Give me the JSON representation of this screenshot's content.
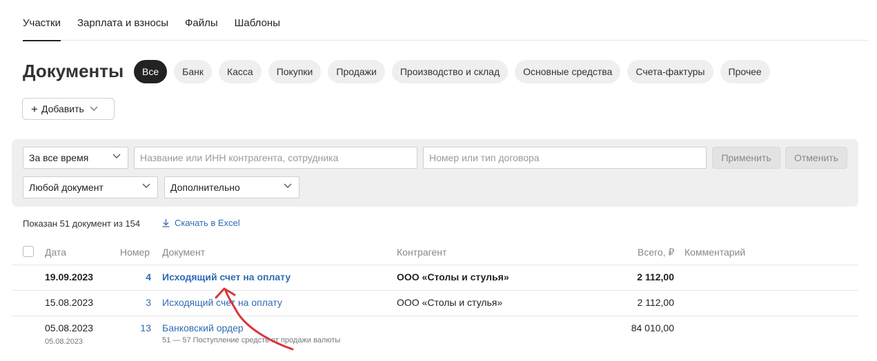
{
  "tabs": [
    {
      "label": "Участки",
      "active": true
    },
    {
      "label": "Зарплата и взносы",
      "active": false
    },
    {
      "label": "Файлы",
      "active": false
    },
    {
      "label": "Шаблоны",
      "active": false
    }
  ],
  "page_title": "Документы",
  "chips": [
    {
      "label": "Все",
      "active": true
    },
    {
      "label": "Банк",
      "active": false
    },
    {
      "label": "Касса",
      "active": false
    },
    {
      "label": "Покупки",
      "active": false
    },
    {
      "label": "Продажи",
      "active": false
    },
    {
      "label": "Производство и склад",
      "active": false
    },
    {
      "label": "Основные средства",
      "active": false
    },
    {
      "label": "Счета-фактуры",
      "active": false
    },
    {
      "label": "Прочее",
      "active": false
    }
  ],
  "add_button": {
    "label": "Добавить",
    "icon": "plus-icon"
  },
  "filters": {
    "period": "За все время",
    "contractor_placeholder": "Название или ИНН контрагента, сотрудника",
    "contract_placeholder": "Номер или тип договора",
    "apply": "Применить",
    "cancel": "Отменить",
    "doc_type": "Любой документ",
    "extra": "Дополнительно"
  },
  "summary": "Показан 51 документ из 154",
  "excel_link": "Скачать в Excel",
  "columns": {
    "date": "Дата",
    "number": "Номер",
    "document": "Документ",
    "contractor": "Контрагент",
    "total": "Всего, ₽",
    "comment": "Комментарий"
  },
  "rows": [
    {
      "date": "19.09.2023",
      "number": "4",
      "document": "Исходящий счет на оплату",
      "contractor": "ООО «Столы и стулья»",
      "total": "2 112,00"
    },
    {
      "date": "15.08.2023",
      "number": "3",
      "document": "Исходящий счет на оплату",
      "contractor": "ООО «Столы и стулья»",
      "total": "2 112,00"
    },
    {
      "date": "05.08.2023",
      "date2": "05.08.2023",
      "number": "13",
      "document": "Банковский ордер",
      "document_sub": "51 — 57 Поступление средств от продажи валюты",
      "contractor": "",
      "total": "84 010,00"
    }
  ],
  "colors": {
    "accent_link": "#2e6bb3",
    "annotation_arrow": "#d8343c",
    "active_chip": "#222222"
  }
}
